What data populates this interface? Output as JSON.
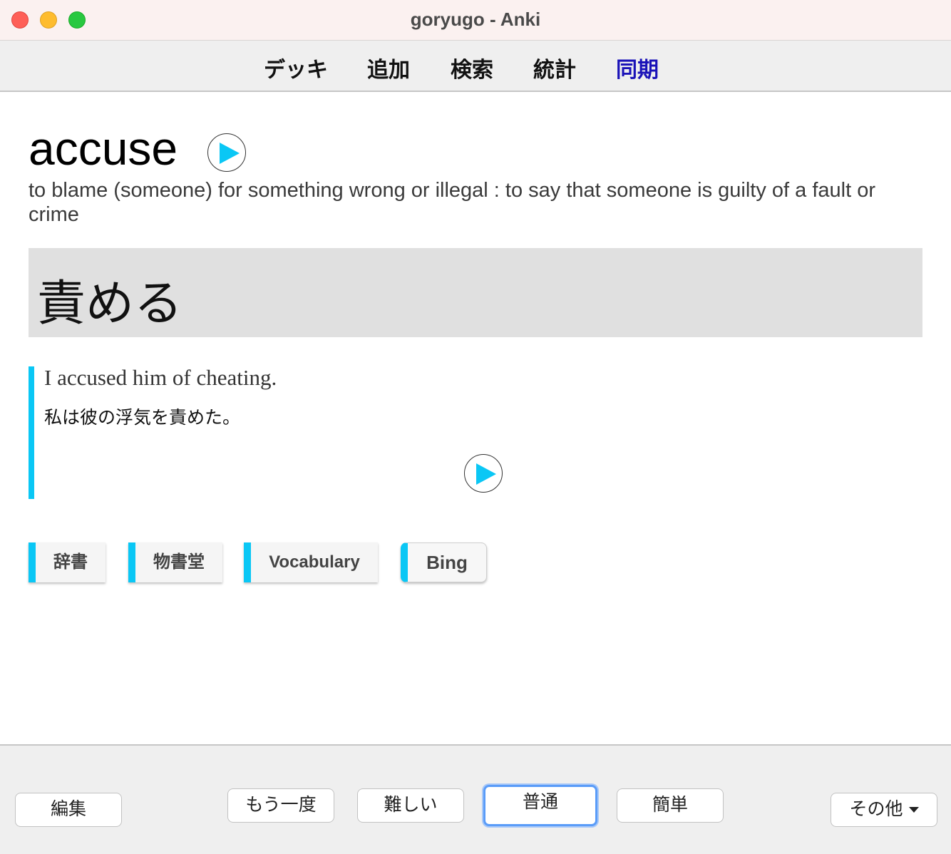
{
  "window": {
    "title": "goryugo - Anki"
  },
  "menu": {
    "items": [
      {
        "label": "デッキ"
      },
      {
        "label": "追加"
      },
      {
        "label": "検索"
      },
      {
        "label": "統計"
      },
      {
        "label": "同期"
      }
    ],
    "sync_color": "#1a12b8"
  },
  "card": {
    "word": "accuse",
    "definition": "to blame (someone) for something wrong or illegal : to say that someone is guilty of a fault or crime",
    "japanese": "責める",
    "example_en": "I accused him of cheating.",
    "example_jp": "私は彼の浮気を責めた。",
    "accent_color": "#0ac7f5",
    "links": [
      {
        "label": "辞書"
      },
      {
        "label": "物書堂"
      },
      {
        "label": "Vocabulary"
      },
      {
        "label": "Bing"
      }
    ]
  },
  "bottom": {
    "edit": "編集",
    "again": "もう一度",
    "hard": "難しい",
    "good": "普通",
    "easy": "簡単",
    "more": "その他"
  }
}
